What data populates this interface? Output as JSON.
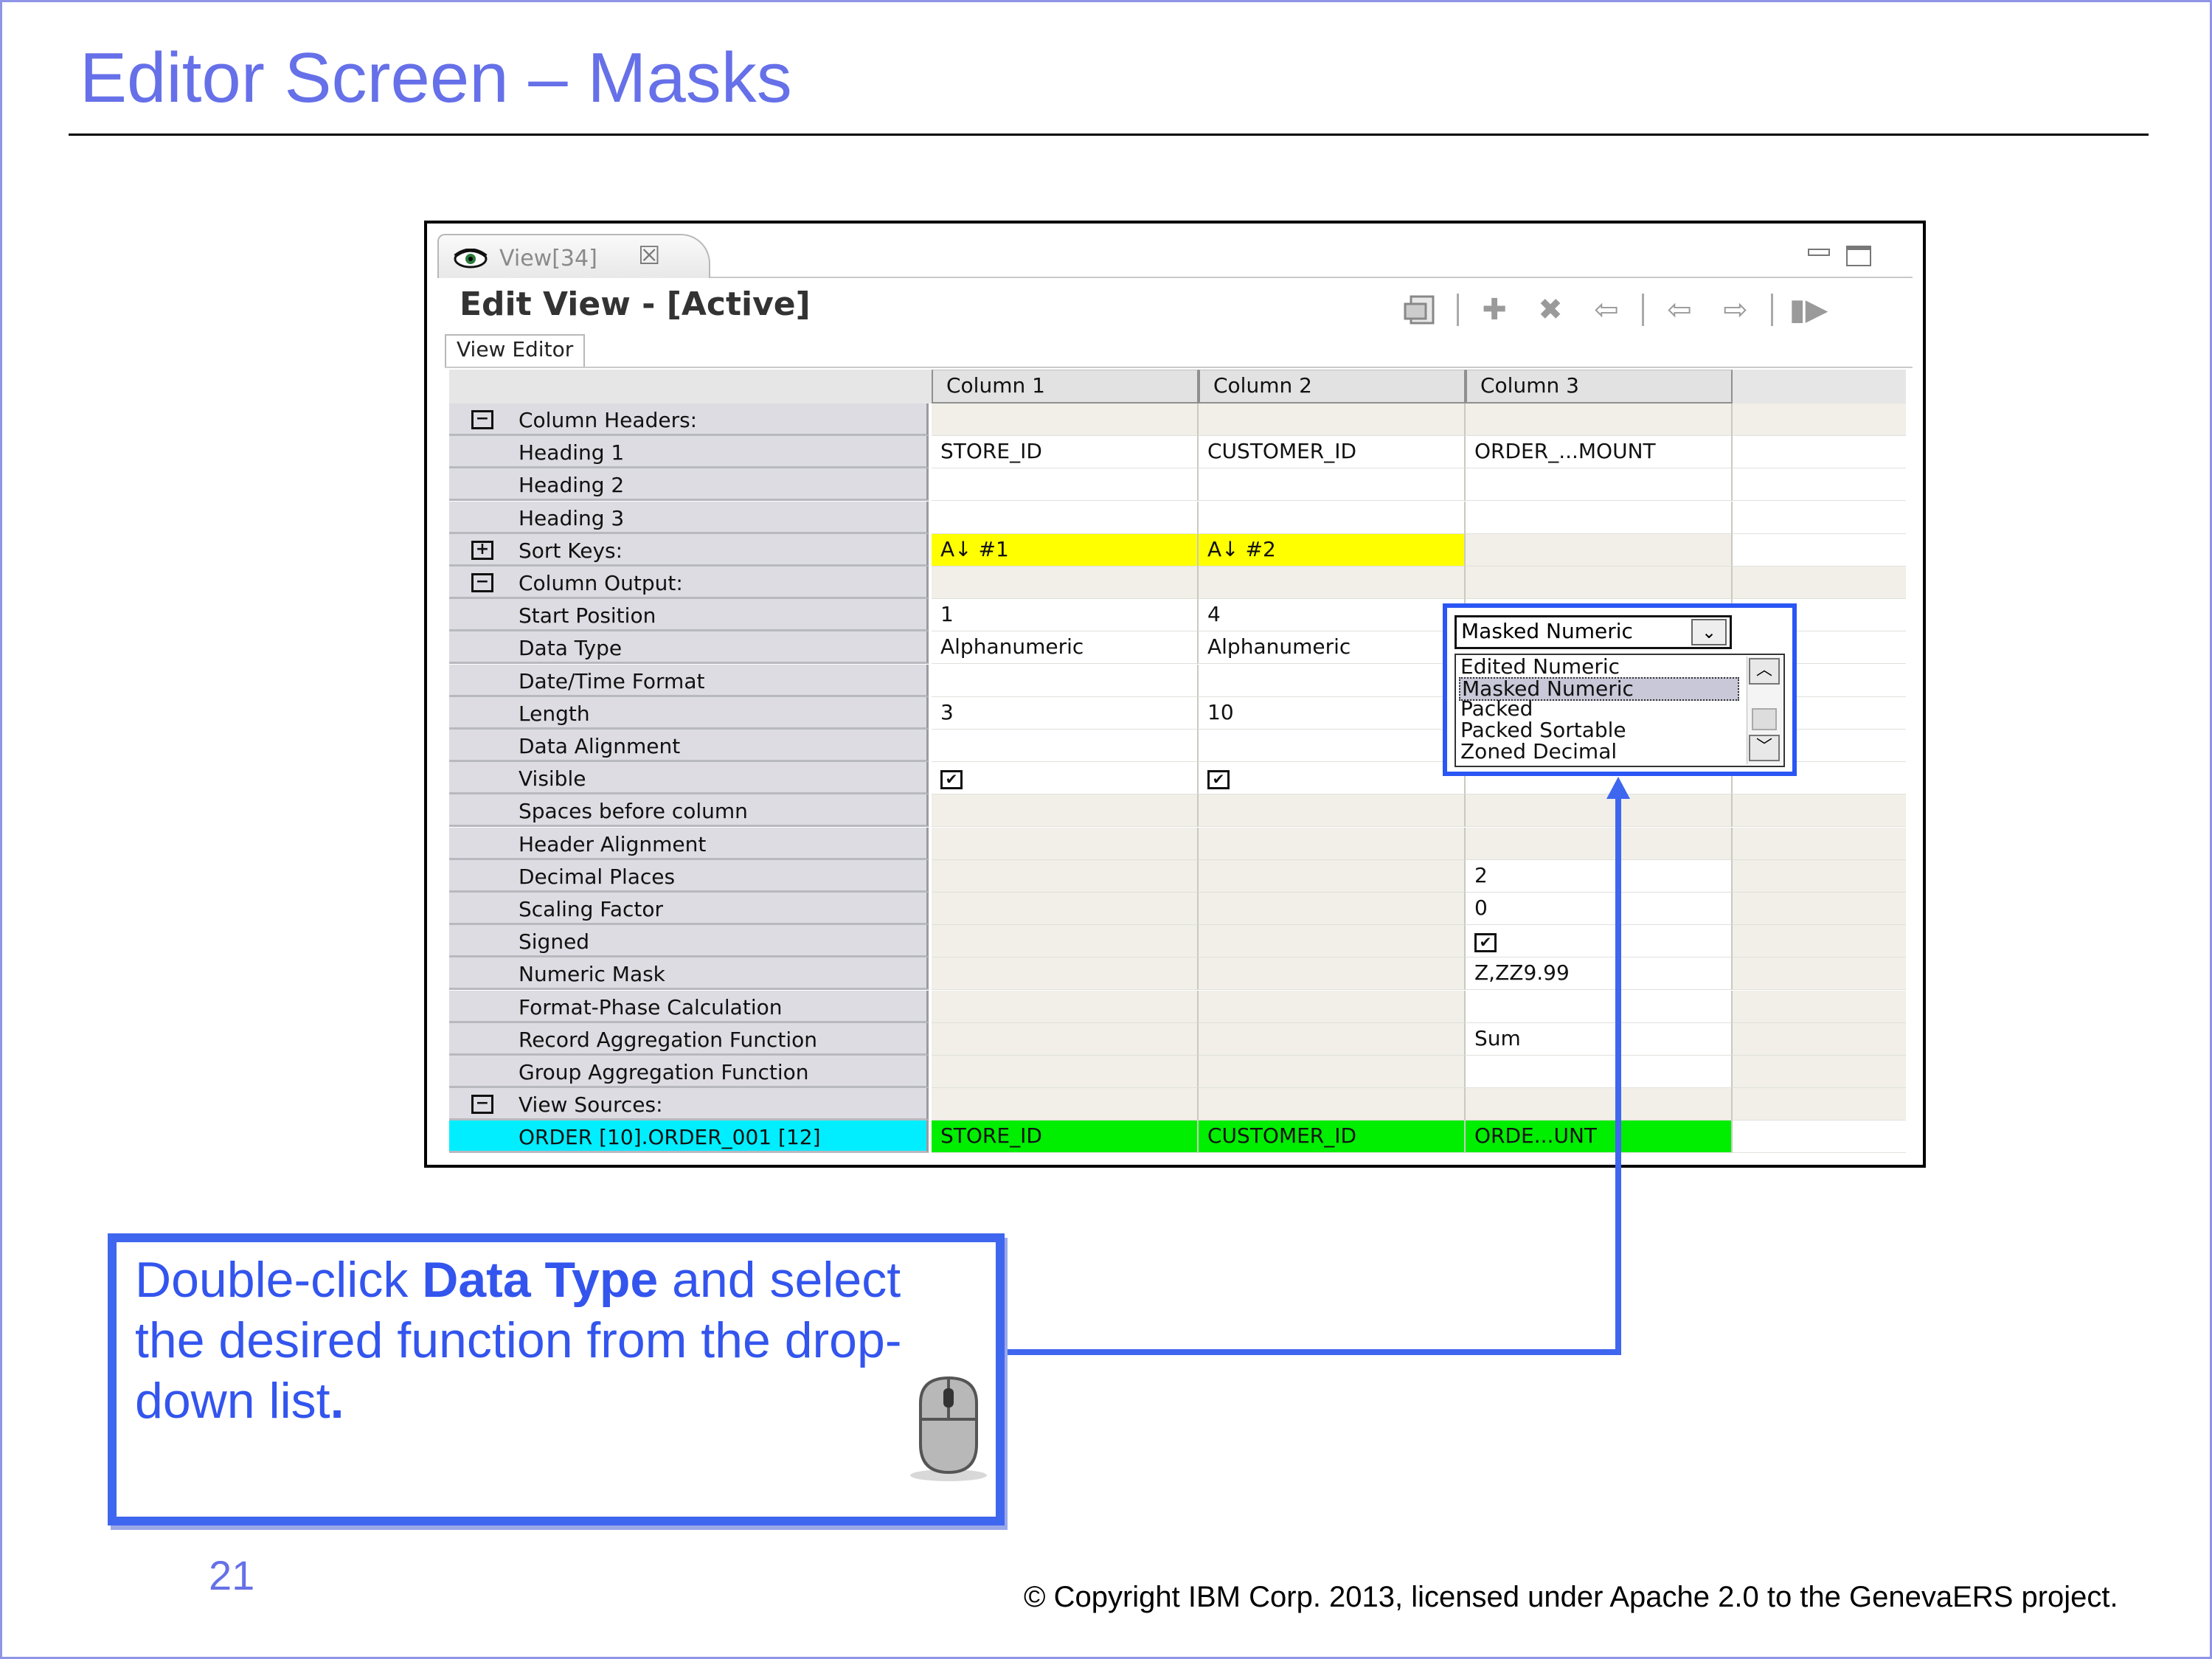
{
  "slide": {
    "title": "Editor Screen – Masks",
    "page_number": "21",
    "copyright": "© Copyright IBM Corp. 2013, licensed under Apache 2.0 to the GenevaERS project."
  },
  "window": {
    "tab_label": "View[34]",
    "tab_close": "☒",
    "title": "Edit View - [Active]",
    "subtab": "View Editor",
    "toolbar_icons": [
      "save-as-icon",
      "add-icon",
      "delete-icon",
      "back-arrow-icon",
      "left-arrow-icon",
      "right-arrow-icon",
      "next-icon"
    ]
  },
  "grid": {
    "columns": [
      "Column 1",
      "Column 2",
      "Column 3"
    ],
    "rows": [
      {
        "label": "Column Headers:",
        "toggle": "−",
        "c1": "",
        "c2": "",
        "c3": ""
      },
      {
        "label": "Heading 1",
        "c1": "STORE_ID",
        "c2": "CUSTOMER_ID",
        "c3": "ORDER_...MOUNT"
      },
      {
        "label": "Heading 2",
        "c1": "",
        "c2": "",
        "c3": ""
      },
      {
        "label": "Heading 3",
        "c1": "",
        "c2": "",
        "c3": ""
      },
      {
        "label": "Sort Keys:",
        "toggle": "+",
        "c1": "A↓ #1",
        "c2": "A↓ #2",
        "c3": ""
      },
      {
        "label": "Column Output:",
        "toggle": "−",
        "c1": "",
        "c2": "",
        "c3": ""
      },
      {
        "label": "Start Position",
        "c1": "1",
        "c2": "4",
        "c3": ""
      },
      {
        "label": "Data Type",
        "c1": "Alphanumeric",
        "c2": "Alphanumeric",
        "c3": ""
      },
      {
        "label": "Date/Time Format",
        "c1": "",
        "c2": "",
        "c3": ""
      },
      {
        "label": "Length",
        "c1": "3",
        "c2": "10",
        "c3": ""
      },
      {
        "label": "Data Alignment",
        "c1": "",
        "c2": "",
        "c3": ""
      },
      {
        "label": "Visible",
        "c1": "✔",
        "c2": "✔",
        "c3": ""
      },
      {
        "label": "Spaces before column",
        "c1": "",
        "c2": "",
        "c3": ""
      },
      {
        "label": "Header Alignment",
        "c1": "",
        "c2": "",
        "c3": ""
      },
      {
        "label": "Decimal Places",
        "c1": "",
        "c2": "",
        "c3": "2"
      },
      {
        "label": "Scaling Factor",
        "c1": "",
        "c2": "",
        "c3": "0"
      },
      {
        "label": "Signed",
        "c1": "",
        "c2": "",
        "c3": "✔"
      },
      {
        "label": "Numeric Mask",
        "c1": "",
        "c2": "",
        "c3": "Z,ZZ9.99"
      },
      {
        "label": "Format-Phase Calculation",
        "c1": "",
        "c2": "",
        "c3": ""
      },
      {
        "label": "Record Aggregation Function",
        "c1": "",
        "c2": "",
        "c3": "Sum"
      },
      {
        "label": "Group Aggregation Function",
        "c1": "",
        "c2": "",
        "c3": ""
      },
      {
        "label": "View Sources:",
        "toggle": "−",
        "c1": "",
        "c2": "",
        "c3": ""
      },
      {
        "label": "ORDER [10].ORDER_001 [12]",
        "c1": "STORE_ID",
        "c2": "CUSTOMER_ID",
        "c3": "ORDE...UNT"
      }
    ]
  },
  "dropdown": {
    "selected": "Masked Numeric",
    "options": [
      "Edited Numeric",
      "Masked Numeric",
      "Packed",
      "Packed Sortable",
      "Zoned Decimal"
    ],
    "highlighted_index": 1
  },
  "callout": {
    "text_pre": "Double-click ",
    "text_bold": "Data Type",
    "text_post": " and select the desired function from the drop-down list",
    "text_end": "."
  },
  "colors": {
    "title": "#6670e8",
    "callout_border": "#3f66ee",
    "sort_key_bg": "#ffff00",
    "source_bg": "#00ee00",
    "source_label_bg": "#00eeff"
  }
}
